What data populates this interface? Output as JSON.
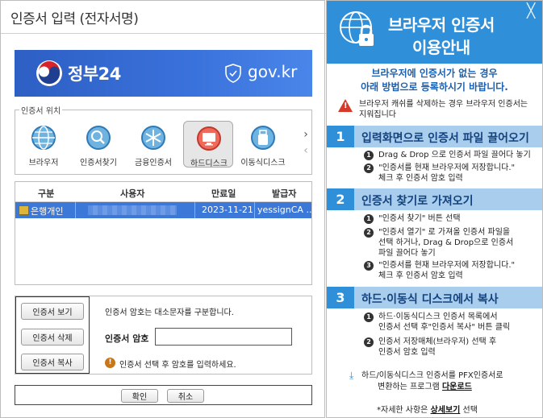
{
  "dialog": {
    "title": "인증서 입력 (전자서명)",
    "banner": {
      "brand": "정부24",
      "domain": "gov.kr"
    },
    "location": {
      "legend": "인증서 위치",
      "items": [
        {
          "label": "브라우저",
          "icon": "globe-icon"
        },
        {
          "label": "인증서찾기",
          "icon": "search-icon"
        },
        {
          "label": "금융인증서",
          "icon": "asterisk-icon"
        },
        {
          "label": "하드디스크",
          "icon": "monitor-icon",
          "selected": true
        },
        {
          "label": "이동식디스크",
          "icon": "usb-icon"
        }
      ],
      "next": "›",
      "prev": "‹"
    },
    "table": {
      "headers": [
        "구분",
        "사용자",
        "만료일",
        "발급자"
      ],
      "rows": [
        {
          "type": "은행개인",
          "user": "",
          "expiry": "2023-11-21",
          "issuer": "yessignCA ..."
        }
      ]
    },
    "buttons": {
      "view": "인증서 보기",
      "delete": "인증서 삭제",
      "copy": "인증서 복사"
    },
    "password": {
      "info": "인증서 암호는 대소문자를 구분합니다.",
      "label": "인증서 암호",
      "value": "",
      "warning": "인증서 선택 후 암호를 입력하세요.",
      "warning_icon": "!"
    },
    "footer": {
      "ok": "확인",
      "cancel": "취소"
    }
  },
  "guide": {
    "title": "브라우저 인증서",
    "subtitle": "이용안내",
    "close": "╳",
    "intro_1": "브라우저에 인증서가 없는 경우",
    "intro_2": "아래 방법으로 등록하시기 바랍니다.",
    "warn_1": "브라우저 캐쉬를 삭제하는 경우 브라우저 인증서는",
    "warn_2": "지워집니다",
    "steps": [
      {
        "num": "1",
        "title": "입력화면으로 인증서 파일 끌어오기",
        "items": [
          {
            "num": "1",
            "lines": [
              "Drag & Drop 으로 인증서 파일 끌어다 놓기"
            ]
          },
          {
            "num": "2",
            "lines": [
              "\"인증서를 현재 브라우저에 저장합니다.\"",
              "체크 후 인증서 암호 입력"
            ]
          }
        ]
      },
      {
        "num": "2",
        "title": "인증서 찾기로 가져오기",
        "items": [
          {
            "num": "1",
            "lines": [
              "\"인증서 찾기\" 버튼 선택"
            ]
          },
          {
            "num": "2",
            "lines": [
              "\"인증서 열기\" 로 가져올 인증서 파일을",
              "선택 하거나, Drag & Drop으로 인증서",
              "파일 끌어다 놓기"
            ]
          },
          {
            "num": "3",
            "lines": [
              "\"인증서를 현재 브라우저에 저장합니다.\"",
              "체크 후 인증서 암호 입력"
            ]
          }
        ]
      },
      {
        "num": "3",
        "title": "하드·이동식 디스크에서 복사",
        "items": [
          {
            "num": "1",
            "lines": [
              "하드·이동식디스크 인증서 목록에서",
              "인증서 선택 후\"인증서 복사\" 버튼 클릭"
            ]
          },
          {
            "num": "2",
            "lines": [
              "인증서 저장매체(브라우저) 선택 후",
              "인증서 암호 입력"
            ]
          }
        ]
      }
    ],
    "download_1": "하드/이동식디스크 인증서를 PFX인증서로",
    "download_2_pre": "변환하는 프로그램 ",
    "download_link": "다운로드",
    "detail_pre": "*자세한 사항은 ",
    "detail_link": "상세보기",
    "detail_post": " 선택"
  }
}
